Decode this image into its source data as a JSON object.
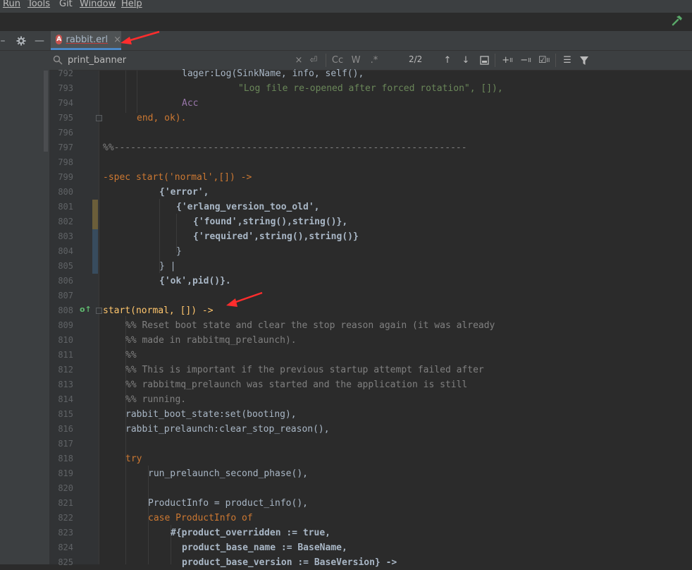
{
  "menu": [
    "Run",
    "Tools",
    "Git",
    "Window",
    "Help"
  ],
  "tab": {
    "label": "rabbit.erl",
    "icon_letter": "A"
  },
  "search": {
    "query": "print_banner",
    "match_count": "2/2",
    "match_case_label": "Cc",
    "words_label": "W",
    "regex_label": ".*"
  },
  "colors": {
    "arrow": "#ff2d2d",
    "tab_accent": "#4a88c7"
  },
  "code": [
    {
      "n": "792",
      "text": "lager:Log(SinkName, info, self(), "
    },
    {
      "n": "793",
      "text": "\"Log file re-opened after forced rotation\", []), "
    },
    {
      "n": "794",
      "text": "Acc"
    },
    {
      "n": "795",
      "text": "end, ok)."
    },
    {
      "n": "796",
      "text": ""
    },
    {
      "n": "797",
      "text": "%%----------------------------------------------------------------"
    },
    {
      "n": "798",
      "text": ""
    },
    {
      "n": "799",
      "text": "-spec start('normal',[]) ->"
    },
    {
      "n": "800",
      "text": "{'error',"
    },
    {
      "n": "801",
      "text": "{'erlang_version_too_old',"
    },
    {
      "n": "802",
      "text": "{'found',string(),string()},"
    },
    {
      "n": "803",
      "text": "{'required',string(),string()}"
    },
    {
      "n": "804",
      "text": "}"
    },
    {
      "n": "805",
      "text": "} |"
    },
    {
      "n": "806",
      "text": "{'ok',pid()}."
    },
    {
      "n": "807",
      "text": ""
    },
    {
      "n": "808",
      "text": "start(normal, []) ->"
    },
    {
      "n": "809",
      "text": "%% Reset boot state and clear the stop reason again (it was already"
    },
    {
      "n": "810",
      "text": "%% made in rabbitmq_prelaunch)."
    },
    {
      "n": "811",
      "text": "%%"
    },
    {
      "n": "812",
      "text": "%% This is important if the previous startup attempt failed after"
    },
    {
      "n": "813",
      "text": "%% rabbitmq_prelaunch was started and the application is still"
    },
    {
      "n": "814",
      "text": "%% running."
    },
    {
      "n": "815",
      "text": "rabbit_boot_state:set(booting),"
    },
    {
      "n": "816",
      "text": "rabbit_prelaunch:clear_stop_reason(),"
    },
    {
      "n": "817",
      "text": ""
    },
    {
      "n": "818",
      "text": "try"
    },
    {
      "n": "819",
      "text": "run_prelaunch_second_phase(),"
    },
    {
      "n": "820",
      "text": ""
    },
    {
      "n": "821",
      "text": "ProductInfo = product_info(),"
    },
    {
      "n": "822",
      "text": "case ProductInfo of"
    },
    {
      "n": "823",
      "text": "#{product_overridden := true,"
    },
    {
      "n": "824",
      "text": "product_base_name := BaseName,"
    },
    {
      "n": "825",
      "text": "product_base_version := BaseVersion} ->"
    }
  ]
}
